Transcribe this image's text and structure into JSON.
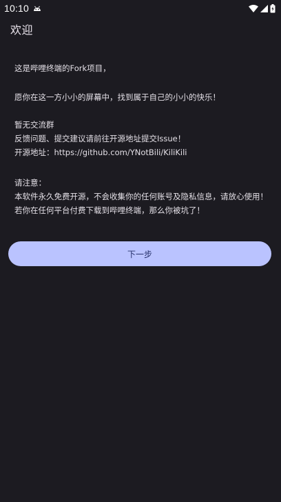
{
  "status_bar": {
    "time": "10:10",
    "icons": [
      "notification-android-icon",
      "wifi-icon",
      "signal-icon",
      "battery-icon"
    ]
  },
  "app_bar": {
    "title": "欢迎"
  },
  "content": {
    "intro": "这是哔哩终端的Fork项目，",
    "wish": "愿你在这一方小小的屏幕中，找到属于自己的小小的快乐！",
    "group": "暂无交流群",
    "feedback": "反馈问题、提交建议请前往开源地址提交Issue！",
    "repo": "开源地址：https://github.com/YNotBili/KiliKili",
    "notice_title": "请注意：",
    "notice_1": "本软件永久免费开源，不会收集你的任何账号及隐私信息，请放心使用！",
    "notice_2": "若你在任何平台付费下载到哔哩终端，那么你被坑了！"
  },
  "actions": {
    "next_label": "下一步"
  },
  "colors": {
    "background": "#1c1b21",
    "button": "#bac3ff",
    "button_text": "#26306a"
  }
}
